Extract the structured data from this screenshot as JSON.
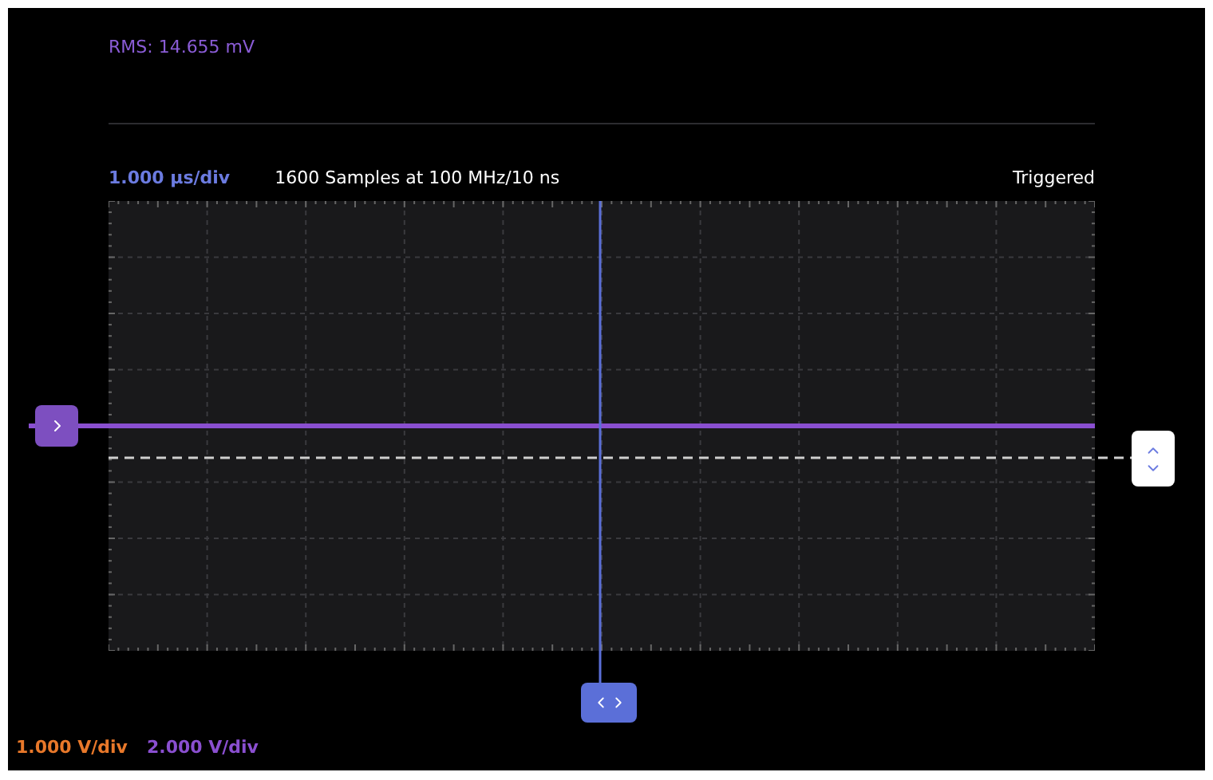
{
  "measurement": {
    "label": "RMS: 14.655 mV",
    "color": "#8a5cd6"
  },
  "header": {
    "timebase": "1.000 µs/div",
    "samples": "1600 Samples at 100 MHz/10 ns",
    "status": "Triggered"
  },
  "channels": [
    {
      "scale": "1.000 V/div",
      "color": "#e8782a"
    },
    {
      "scale": "2.000 V/div",
      "color": "#8a4fd0"
    }
  ]
}
